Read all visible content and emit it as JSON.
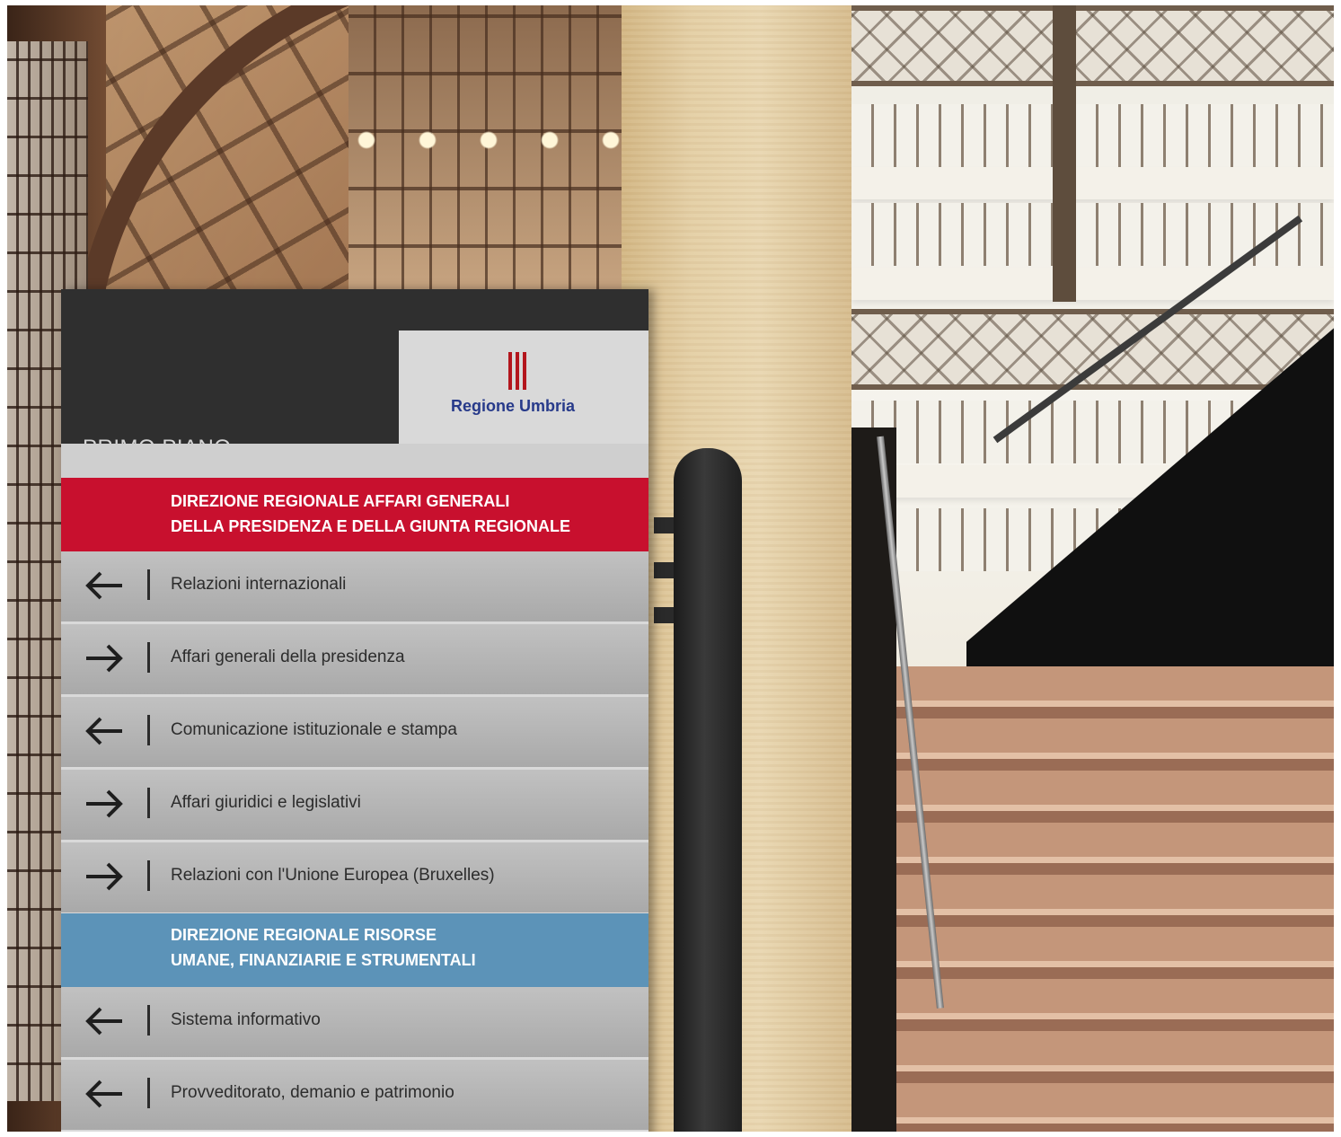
{
  "sign": {
    "floor": "PRIMO PIANO",
    "logo_text": "Regione Umbria",
    "colors": {
      "red_header": "#c8102e",
      "blue_header": "#5c93b8",
      "panel": "#b7b7b7",
      "dark_band": "#2f2f2f",
      "logo_blue": "#273a8a"
    },
    "sections": [
      {
        "title_line1": "DIREZIONE REGIONALE AFFARI GENERALI",
        "title_line2": "DELLA PRESIDENZA E DELLA GIUNTA REGIONALE",
        "rows": [
          {
            "direction": "left-arrow-icon",
            "label": "Relazioni internazionali"
          },
          {
            "direction": "right-arrow-icon",
            "label": "Affari generali della presidenza"
          },
          {
            "direction": "left-arrow-icon",
            "label": "Comunicazione istituzionale e stampa"
          },
          {
            "direction": "right-arrow-icon",
            "label": "Affari giuridici e legislativi"
          },
          {
            "direction": "right-arrow-icon",
            "label": "Relazioni con l'Unione Europea (Bruxelles)"
          }
        ]
      },
      {
        "title_line1": "DIREZIONE REGIONALE RISORSE",
        "title_line2": "UMANE, FINANZIARIE E STRUMENTALI",
        "rows": [
          {
            "direction": "left-arrow-icon",
            "label": "Sistema informativo"
          },
          {
            "direction": "left-arrow-icon",
            "label": "Provveditorato, demanio e patrimonio"
          }
        ]
      }
    ]
  }
}
